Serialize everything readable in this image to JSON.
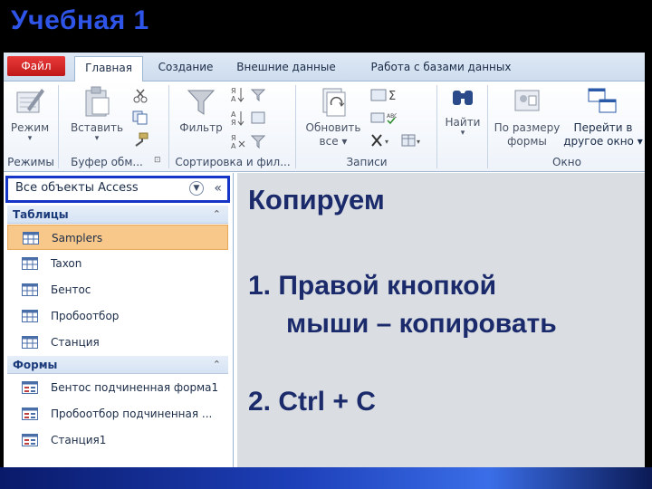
{
  "slide_title": "Учебная 1",
  "ribbon": {
    "tabs": {
      "file": "Файл",
      "home": "Главная",
      "create": "Создание",
      "external": "Внешние данные",
      "database": "Работа с базами данных"
    },
    "buttons": {
      "mode": "Режим",
      "paste": "Вставить",
      "filter": "Фильтр",
      "refresh_line1": "Обновить",
      "refresh_line2": "все",
      "find": "Найти",
      "fit_line1": "По размеру",
      "fit_line2": "формы",
      "switch_line1": "Перейти в",
      "switch_line2": "другое окно"
    },
    "groups": {
      "modes": "Режимы",
      "clipboard": "Буфер обм...",
      "sort": "Сортировка и фил...",
      "records": "Записи",
      "window": "Окно"
    }
  },
  "nav": {
    "header": "Все объекты Access",
    "tables_section": "Таблицы",
    "tables": [
      "Samplers",
      "Taxon",
      "Бентос",
      "Пробоотбор",
      "Станция"
    ],
    "forms_section": "Формы",
    "forms": [
      "Бентос подчиненная форма1",
      "Пробоотбор подчиненная ...",
      "Станция1"
    ]
  },
  "content": {
    "heading": "Копируем",
    "step1_line1": "1. Правой кнопкой",
    "step1_line2": "мыши – копировать",
    "step2": "2. Ctrl + C"
  },
  "colors": {
    "title_blue": "#2f55e8",
    "file_tab_red": "#cc2020",
    "nav_highlight": "#1535c8",
    "selected_row": "#f8c88a"
  }
}
